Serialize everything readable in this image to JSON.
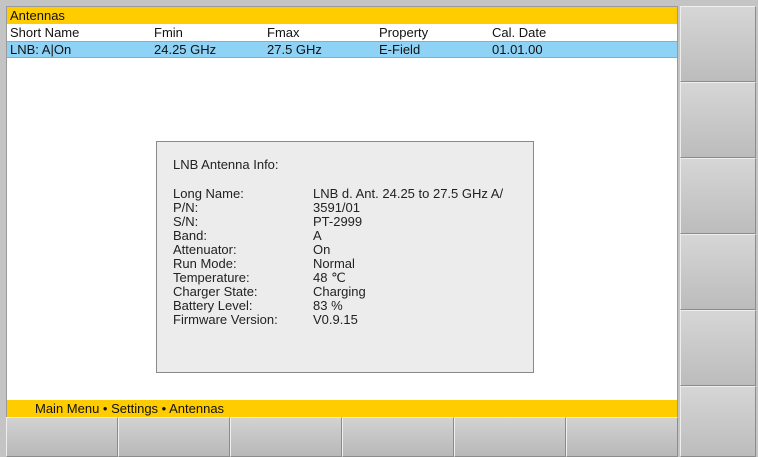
{
  "window": {
    "title": "Antennas"
  },
  "table": {
    "headers": [
      "Short Name",
      "Fmin",
      "Fmax",
      "Property",
      "Cal. Date"
    ],
    "rows": [
      [
        "LNB: A|On",
        "24.25 GHz",
        "27.5 GHz",
        "E-Field",
        "01.01.00"
      ]
    ]
  },
  "info": {
    "title": "LNB Antenna Info:",
    "fields": [
      {
        "label": "Long Name:",
        "value": "LNB d. Ant. 24.25 to 27.5 GHz A/"
      },
      {
        "label": "P/N:",
        "value": "3591/01"
      },
      {
        "label": "S/N:",
        "value": "PT-2999"
      },
      {
        "label": "Band:",
        "value": "A"
      },
      {
        "label": "Attenuator:",
        "value": "On"
      },
      {
        "label": "Run Mode:",
        "value": "Normal"
      },
      {
        "label": "Temperature:",
        "value": "48 ℃"
      },
      {
        "label": "Charger State:",
        "value": "Charging"
      },
      {
        "label": "Battery Level:",
        "value": "83 %"
      },
      {
        "label": "Firmware Version:",
        "value": "V0.9.15"
      }
    ]
  },
  "breadcrumb": "Main Menu • Settings • Antennas",
  "colors": {
    "accent": "#ffcc00",
    "selected_row": "#8ed3f5",
    "button": "#c8c8c8"
  }
}
